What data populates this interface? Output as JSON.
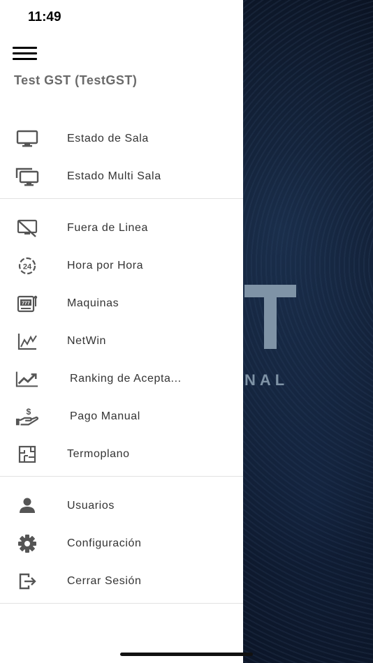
{
  "status_bar": {
    "time": "11:49"
  },
  "background": {
    "logo_letter": "T",
    "tagline": "NAL"
  },
  "drawer": {
    "account_title": "Test GST (TestGST)",
    "sections": [
      {
        "items": [
          {
            "label": "Estado de Sala",
            "icon": "monitor-icon"
          },
          {
            "label": "Estado Multi Sala",
            "icon": "multi-monitor-icon"
          }
        ]
      },
      {
        "items": [
          {
            "label": "Fuera de Linea",
            "icon": "monitor-off-icon"
          },
          {
            "label": "Hora por Hora",
            "icon": "clock-24-icon"
          },
          {
            "label": "Maquinas",
            "icon": "slot-machine-icon"
          },
          {
            "label": "NetWin",
            "icon": "line-chart-icon"
          },
          {
            "label": "Ranking de Acepta...",
            "icon": "trending-up-icon"
          },
          {
            "label": "Pago Manual",
            "icon": "hand-dollar-icon"
          },
          {
            "label": "Termoplano",
            "icon": "floor-plan-icon"
          }
        ]
      },
      {
        "items": [
          {
            "label": "Usuarios",
            "icon": "user-icon"
          },
          {
            "label": "Configuración",
            "icon": "gear-icon"
          },
          {
            "label": "Cerrar Sesión",
            "icon": "logout-icon"
          }
        ]
      }
    ]
  }
}
